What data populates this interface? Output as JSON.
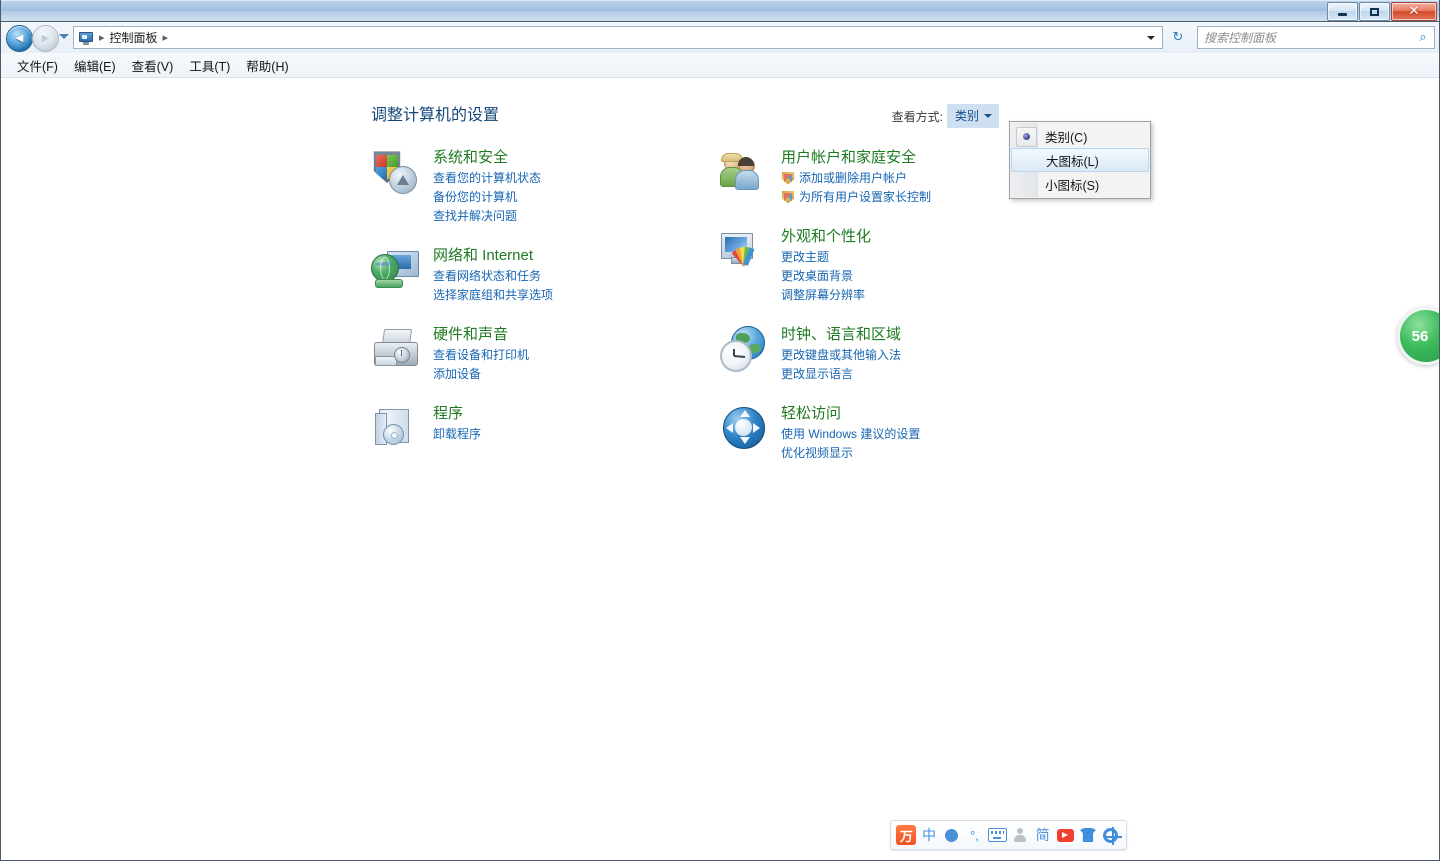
{
  "window": {
    "controls": {
      "minimize": "minimize-button",
      "maximize": "maximize-button",
      "close": "✕"
    }
  },
  "navbar": {
    "back_tooltip": "后退",
    "forward_tooltip": "前进",
    "breadcrumb_icon": "control-panel-icon",
    "breadcrumb": "控制面板",
    "separator": "▸",
    "refresh_icon": "↻",
    "search": {
      "placeholder": "搜索控制面板",
      "value": "",
      "icon": "⌕"
    }
  },
  "menubar": {
    "items": [
      {
        "label": "文件(F)"
      },
      {
        "label": "编辑(E)"
      },
      {
        "label": "查看(V)"
      },
      {
        "label": "工具(T)"
      },
      {
        "label": "帮助(H)"
      }
    ]
  },
  "content": {
    "page_title": "调整计算机的设置",
    "viewby": {
      "label": "查看方式:",
      "value": "类别",
      "menu": [
        {
          "label": "类别(C)",
          "selected": true,
          "hovered": false
        },
        {
          "label": "大图标(L)",
          "selected": false,
          "hovered": true
        },
        {
          "label": "小图标(S)",
          "selected": false,
          "hovered": false
        }
      ]
    },
    "categories_left": [
      {
        "icon": "security-shield-icon",
        "title": "系统和安全",
        "links": [
          {
            "label": "查看您的计算机状态",
            "uac": false
          },
          {
            "label": "备份您的计算机",
            "uac": false
          },
          {
            "label": "查找并解决问题",
            "uac": false
          }
        ]
      },
      {
        "icon": "network-globe-icon",
        "title": "网络和 Internet",
        "links": [
          {
            "label": "查看网络状态和任务",
            "uac": false
          },
          {
            "label": "选择家庭组和共享选项",
            "uac": false
          }
        ]
      },
      {
        "icon": "printer-icon",
        "title": "硬件和声音",
        "links": [
          {
            "label": "查看设备和打印机",
            "uac": false
          },
          {
            "label": "添加设备",
            "uac": false
          }
        ]
      },
      {
        "icon": "programs-icon",
        "title": "程序",
        "links": [
          {
            "label": "卸载程序",
            "uac": false
          }
        ]
      }
    ],
    "categories_right": [
      {
        "icon": "users-icon",
        "title": "用户帐户和家庭安全",
        "links": [
          {
            "label": "添加或删除用户帐户",
            "uac": true
          },
          {
            "label": "为所有用户设置家长控制",
            "uac": true
          }
        ]
      },
      {
        "icon": "appearance-icon",
        "title": "外观和个性化",
        "links": [
          {
            "label": "更改主题",
            "uac": false
          },
          {
            "label": "更改桌面背景",
            "uac": false
          },
          {
            "label": "调整屏幕分辨率",
            "uac": false
          }
        ]
      },
      {
        "icon": "clock-region-icon",
        "title": "时钟、语言和区域",
        "links": [
          {
            "label": "更改键盘或其他输入法",
            "uac": false
          },
          {
            "label": "更改显示语言",
            "uac": false
          }
        ]
      },
      {
        "icon": "ease-of-access-icon",
        "title": "轻松访问",
        "links": [
          {
            "label": "使用 Windows 建议的设置",
            "uac": false
          },
          {
            "label": "优化视频显示",
            "uac": false
          }
        ]
      }
    ]
  },
  "badge": {
    "value": "56"
  },
  "ime_toolbar": {
    "items": [
      {
        "name": "ime-logo-icon",
        "glyph": "万"
      },
      {
        "name": "ime-chinese-mode-icon",
        "glyph": "中"
      },
      {
        "name": "ime-moon-icon",
        "glyph": ""
      },
      {
        "name": "ime-punctuation-icon",
        "glyph": "°,"
      },
      {
        "name": "ime-keyboard-icon",
        "glyph": ""
      },
      {
        "name": "ime-user-icon",
        "glyph": ""
      },
      {
        "name": "ime-simplified-icon",
        "glyph": "简"
      },
      {
        "name": "ime-video-icon",
        "glyph": ""
      },
      {
        "name": "ime-skin-icon",
        "glyph": ""
      },
      {
        "name": "ime-settings-gear-icon",
        "glyph": ""
      }
    ]
  },
  "colors": {
    "category_title": "#1f7a22",
    "link": "#1866b4",
    "page_title": "#16477a",
    "accent": "#cfe0f2"
  }
}
